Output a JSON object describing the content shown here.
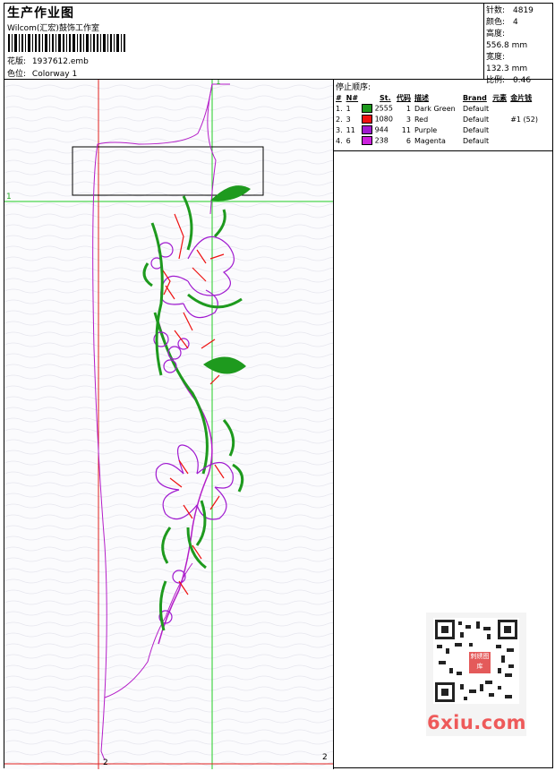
{
  "header": {
    "title": "生产作业图",
    "company": "Wilcom(汇宏)鼓饰工作室",
    "file_label": "花版:",
    "file_name": "1937612.emb",
    "colorway_label": "色位:",
    "colorway": "Colorway 1"
  },
  "stats": [
    {
      "label": "针数:",
      "value": "4819"
    },
    {
      "label": "颜色:",
      "value": "4"
    },
    {
      "label": "高度:",
      "value": "556.8 mm"
    },
    {
      "label": "宽度:",
      "value": "132.3 mm"
    },
    {
      "label": "比例:",
      "value": "0.46"
    }
  ],
  "stop_sequence": {
    "title": "停止顺序:",
    "columns": [
      "#",
      "N#",
      "St.",
      "代码",
      "描述",
      "Brand",
      "元素",
      "金片钱"
    ],
    "rows": [
      {
        "idx": "1.",
        "n": "1",
        "color": "#1e9a1e",
        "st": "2555",
        "code": "1",
        "desc": "Dark Green",
        "brand": "Default",
        "element": "",
        "sequin": ""
      },
      {
        "idx": "2.",
        "n": "3",
        "color": "#ee1111",
        "st": "1080",
        "code": "3",
        "desc": "Red",
        "brand": "Default",
        "element": "",
        "sequin": "#1 (52)"
      },
      {
        "idx": "3.",
        "n": "11",
        "color": "#a01ad0",
        "st": "944",
        "code": "11",
        "desc": "Purple",
        "brand": "Default",
        "element": "",
        "sequin": ""
      },
      {
        "idx": "4.",
        "n": "6",
        "color": "#cc22dd",
        "st": "238",
        "code": "6",
        "desc": "Magenta",
        "brand": "Default",
        "element": "",
        "sequin": ""
      }
    ]
  },
  "axes": {
    "v_label": "1",
    "h_label": "1",
    "bottom_left": "2",
    "bottom_right": "2"
  },
  "qr": {
    "badge": "刺绣图库"
  },
  "watermark": "6xiu.com"
}
